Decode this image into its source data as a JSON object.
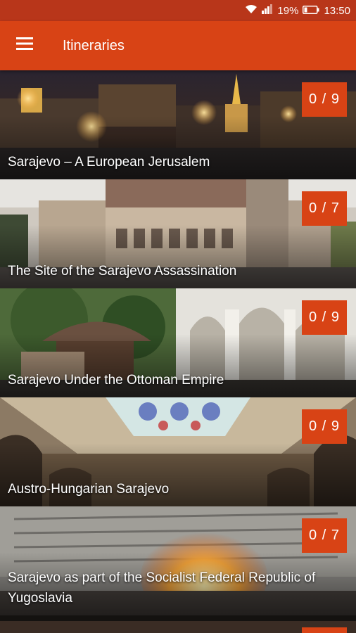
{
  "status_bar": {
    "battery_percent": "19%",
    "time": "13:50",
    "icons": [
      "wifi-icon",
      "signal-icon",
      "battery-icon"
    ]
  },
  "app_bar": {
    "title": "Itineraries",
    "menu_icon": "hamburger-menu-icon"
  },
  "colors": {
    "status_bar": "#b8361a",
    "app_bar": "#d84315",
    "badge": "#d84315"
  },
  "itineraries": [
    {
      "title": "Sarajevo – A European Jerusalem",
      "progress": "0 / 9"
    },
    {
      "title": "The Site of the Sarajevo Assassination",
      "progress": "0 / 7"
    },
    {
      "title": "Sarajevo Under the Ottoman Empire",
      "progress": "0 / 9"
    },
    {
      "title": "Austro-Hungarian Sarajevo",
      "progress": "0 / 9"
    },
    {
      "title": "Sarajevo as part of the Socialist Federal Republic of Yugoslavia",
      "progress": "0 / 7"
    }
  ]
}
